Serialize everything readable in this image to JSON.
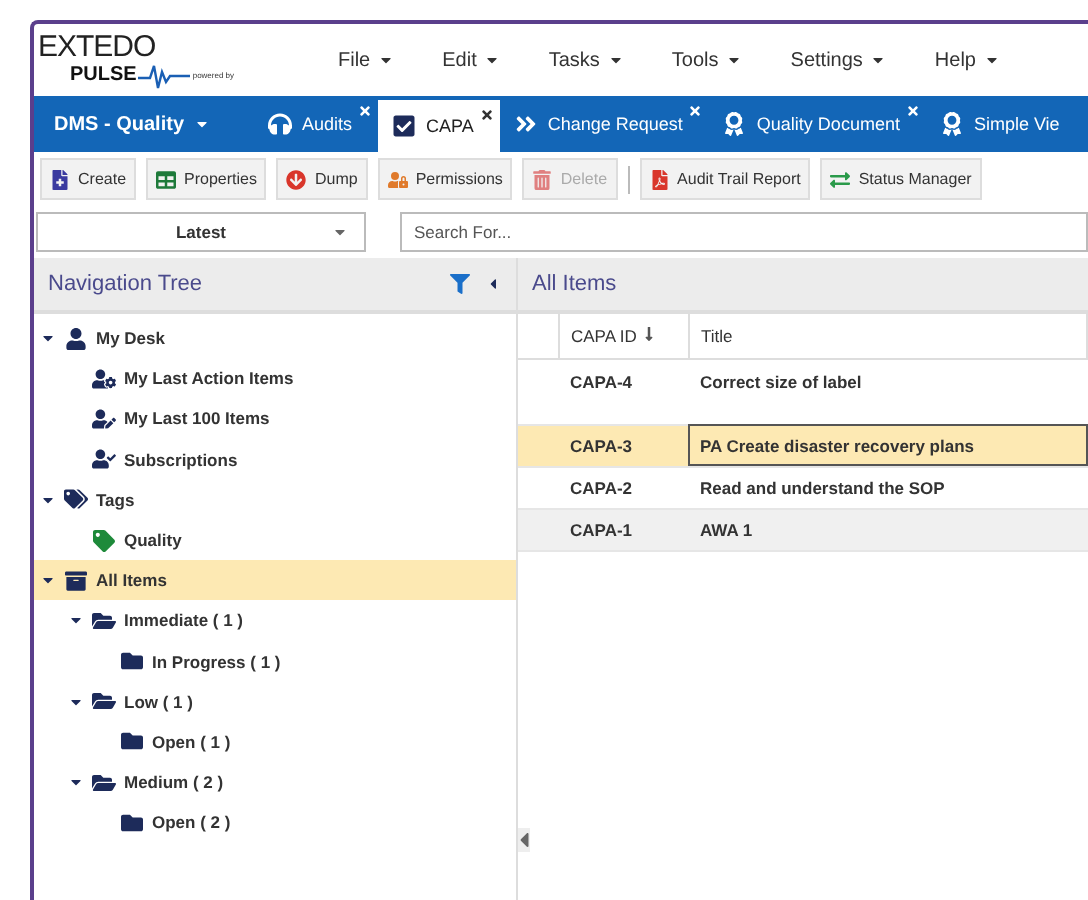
{
  "logo": {
    "line1": "EXTEDO",
    "line2": "PULSE",
    "tagline": "powered by"
  },
  "menu": [
    "File",
    "Edit",
    "Tasks",
    "Tools",
    "Settings",
    "Help"
  ],
  "workspace": "DMS - Quality",
  "tabs": [
    {
      "label": "Audits",
      "kind": "audit",
      "selected": false
    },
    {
      "label": "CAPA",
      "kind": "check",
      "selected": true
    },
    {
      "label": "Change Request",
      "kind": "forward",
      "selected": false
    },
    {
      "label": "Quality Document",
      "kind": "award",
      "selected": false
    },
    {
      "label": "Simple Vie",
      "kind": "award",
      "selected": false
    }
  ],
  "toolbar": [
    {
      "label": "Create",
      "kind": "create",
      "disabled": false
    },
    {
      "label": "Properties",
      "kind": "properties",
      "disabled": false
    },
    {
      "label": "Dump",
      "kind": "dump",
      "disabled": false
    },
    {
      "label": "Permissions",
      "kind": "permissions",
      "disabled": false
    },
    {
      "label": "Delete",
      "kind": "delete",
      "disabled": true
    },
    {
      "label": "Audit Trail Report",
      "kind": "report",
      "disabled": false
    },
    {
      "label": "Status Manager",
      "kind": "status",
      "disabled": false
    }
  ],
  "version_select": "Latest",
  "search": {
    "placeholder": "Search For..."
  },
  "nav": {
    "title": "Navigation Tree",
    "tree": [
      {
        "label": "My Desk",
        "kind": "desk",
        "expanded": true,
        "selected": false,
        "children": [
          {
            "label": "My Last Action Items",
            "kind": "action",
            "selected": false
          },
          {
            "label": "My Last 100 Items",
            "kind": "recent",
            "selected": false
          },
          {
            "label": "Subscriptions",
            "kind": "subscription",
            "selected": false
          }
        ]
      },
      {
        "label": "Tags",
        "kind": "tags",
        "expanded": true,
        "selected": false,
        "children": [
          {
            "label": "Quality",
            "kind": "tag",
            "selected": false
          }
        ]
      },
      {
        "label": "All Items",
        "kind": "archive",
        "expanded": true,
        "selected": true,
        "children": [
          {
            "label": "Immediate ( 1 )",
            "kind": "folder",
            "expanded": true,
            "selected": false,
            "children": [
              {
                "label": "In Progress ( 1 )",
                "kind": "folder",
                "selected": false
              }
            ]
          },
          {
            "label": "Low ( 1 )",
            "kind": "folder",
            "expanded": true,
            "selected": false,
            "children": [
              {
                "label": "Open ( 1 )",
                "kind": "folder",
                "selected": false
              }
            ]
          },
          {
            "label": "Medium ( 2 )",
            "kind": "folder",
            "expanded": true,
            "selected": false,
            "children": [
              {
                "label": "Open ( 2 )",
                "kind": "folder",
                "selected": false
              }
            ]
          }
        ]
      }
    ]
  },
  "list": {
    "title": "All Items",
    "columns": [
      "CAPA ID",
      "Title"
    ],
    "rows": [
      {
        "id": "CAPA-4",
        "title": "Correct size of label",
        "selected": false
      },
      {
        "id": "CAPA-3",
        "title": "PA Create disaster recovery plans",
        "selected": true
      },
      {
        "id": "CAPA-2",
        "title": "Read and understand the SOP",
        "selected": false
      },
      {
        "id": "CAPA-1",
        "title": "AWA 1",
        "selected": false
      }
    ]
  }
}
